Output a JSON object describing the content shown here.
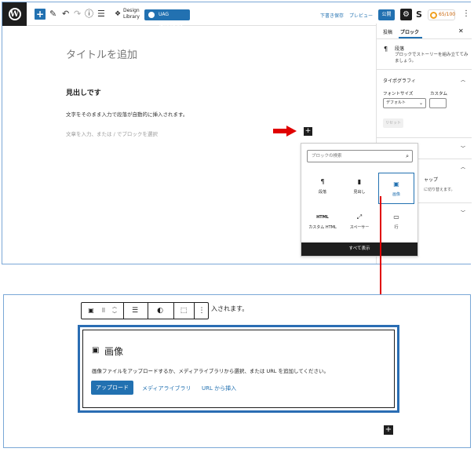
{
  "topbar": {
    "design_library": "Design\nLibrary",
    "uag_templates": "UAG Templates",
    "save_draft": "下書き保存",
    "preview": "プレビュー",
    "publish": "公開",
    "score": "65/100"
  },
  "editor": {
    "title_placeholder": "タイトルを追加",
    "heading": "見出しです",
    "paragraph": "文字をそのまま入力で段落が自動的に挿入されます。",
    "paragraph_placeholder": "文章を入力、または / でブロックを選択"
  },
  "sidebar": {
    "tab_post": "投稿",
    "tab_block": "ブロック",
    "block_name": "段落",
    "block_desc": "ブロックでストーリーを組み立ててみましょう。",
    "typography": "タイポグラフィ",
    "font_size_label": "フォントサイズ",
    "custom_label": "カスタム",
    "font_size_value": "デフォルト",
    "reset": "リセット",
    "partial_1": "ャップ",
    "partial_2": "に切り替えます。"
  },
  "inserter": {
    "search_placeholder": "ブロックの検索",
    "items": [
      {
        "label": "段落",
        "icon": "paragraph-icon"
      },
      {
        "label": "見出し",
        "icon": "bookmark-icon"
      },
      {
        "label": "画像",
        "icon": "image-icon"
      },
      {
        "label": "カスタム HTML",
        "icon": "html-icon"
      },
      {
        "label": "スペーサー",
        "icon": "spacer-icon"
      },
      {
        "label": "行",
        "icon": "row-icon"
      }
    ],
    "show_all": "すべて表示"
  },
  "bottom": {
    "behind_text": "入されます。",
    "image_title": "画像",
    "image_desc": "画像ファイルをアップロードするか、メディアライブラリから選択、または URL を追加してください。",
    "upload": "アップロード",
    "media_library": "メディアライブラリ",
    "insert_from_url": "URL から挿入"
  },
  "colors": {
    "accent": "#2271b1",
    "dark": "#1e1e1e",
    "arrow_red": "#e00000",
    "frame_blue": "#2a6db3"
  }
}
